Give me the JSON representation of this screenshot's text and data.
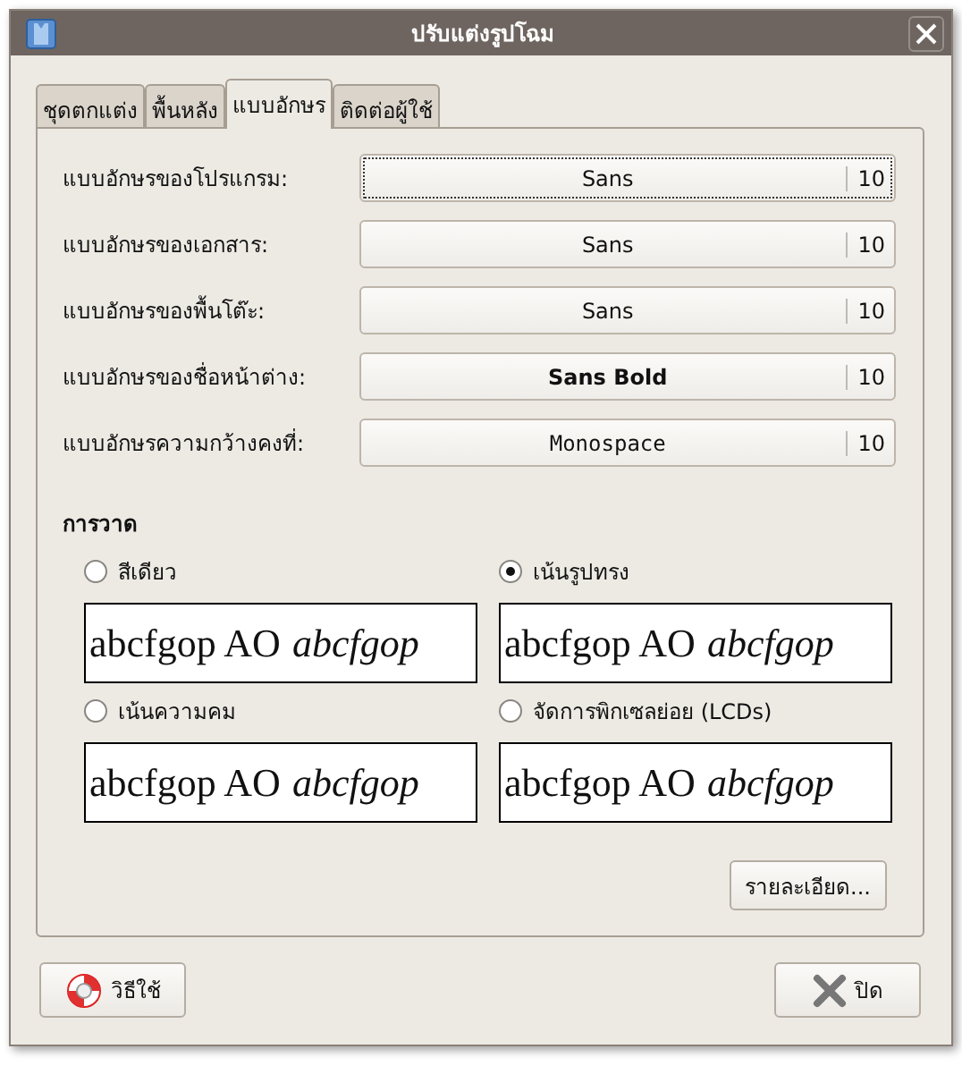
{
  "window": {
    "title": "ปรับแต่งรูปโฉม"
  },
  "tabs": [
    {
      "label": "ชุดตกแต่ง",
      "selected": false
    },
    {
      "label": "พื้นหลัง",
      "selected": false
    },
    {
      "label": "แบบอักษร",
      "selected": true
    },
    {
      "label": "ติดต่อผู้ใช้",
      "selected": false
    }
  ],
  "fonts": [
    {
      "label": "แบบอักษรของโปรแกรม:",
      "font": "Sans",
      "size": "10",
      "kind": "regular",
      "focused": true
    },
    {
      "label": "แบบอักษรของเอกสาร:",
      "font": "Sans",
      "size": "10",
      "kind": "regular",
      "focused": false
    },
    {
      "label": "แบบอักษรของพื้นโต๊ะ:",
      "font": "Sans",
      "size": "10",
      "kind": "regular",
      "focused": false
    },
    {
      "label": "แบบอักษรของชื่อหน้าต่าง:",
      "font": "Sans Bold",
      "size": "10",
      "kind": "bold",
      "focused": false
    },
    {
      "label": "แบบอักษรความกว้างคงที่:",
      "font": "Monospace",
      "size": "10",
      "kind": "mono",
      "focused": false
    }
  ],
  "rendering": {
    "title": "การวาด",
    "options": [
      {
        "label": "สีเดียว",
        "selected": false,
        "sample": "abcfgop AO",
        "sample_italic": "abcfgop"
      },
      {
        "label": "เน้นรูปทรง",
        "selected": true,
        "sample": "abcfgop AO",
        "sample_italic": "abcfgop"
      },
      {
        "label": "เน้นความคม",
        "selected": false,
        "sample": "abcfgop AO",
        "sample_italic": "abcfgop"
      },
      {
        "label": "จัดการพิกเซลย่อย (LCDs)",
        "selected": false,
        "sample": "abcfgop AO",
        "sample_italic": "abcfgop"
      }
    ],
    "details_button": "รายละเอียด..."
  },
  "buttons": {
    "help": "วิธีใช้",
    "close": "ปิด"
  }
}
